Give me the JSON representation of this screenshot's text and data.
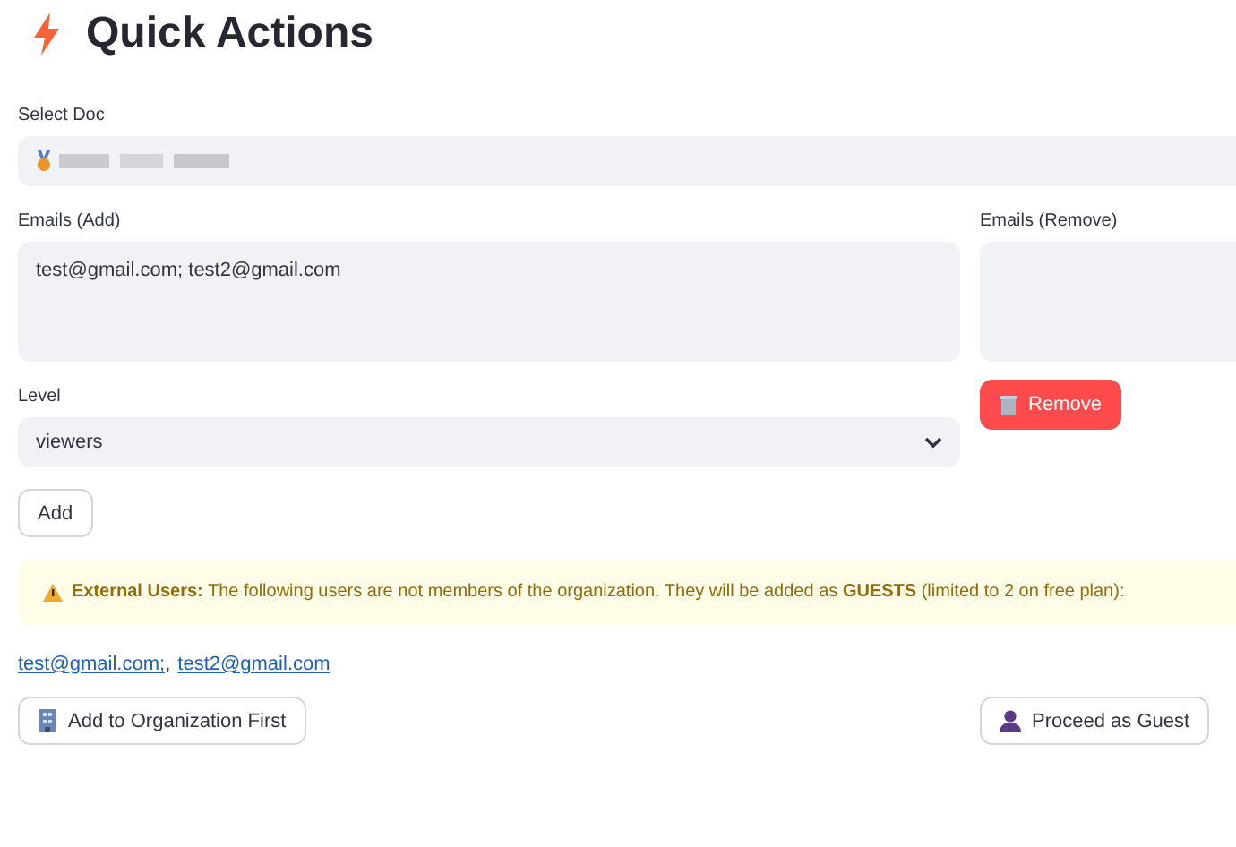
{
  "title": "Quick Actions",
  "select_doc": {
    "label": "Select Doc"
  },
  "emails_add": {
    "label": "Emails (Add)",
    "value": "test@gmail.com; test2@gmail.com"
  },
  "emails_remove": {
    "label": "Emails (Remove)"
  },
  "level": {
    "label": "Level",
    "value": "viewers"
  },
  "add_button": "Add",
  "remove_button": "Remove",
  "warning": "**External Users:** The following users are not members of the organization. They will be added as **GUESTS** (limited to 2 on free plan):",
  "guest_links": [
    "test@gmail.com;",
    "test2@gmail.com"
  ],
  "link_separator": ",",
  "actions": [
    {
      "label": "Add to Organization First",
      "kind": "building"
    },
    {
      "label": "Proceed as Guest",
      "kind": "person"
    }
  ]
}
